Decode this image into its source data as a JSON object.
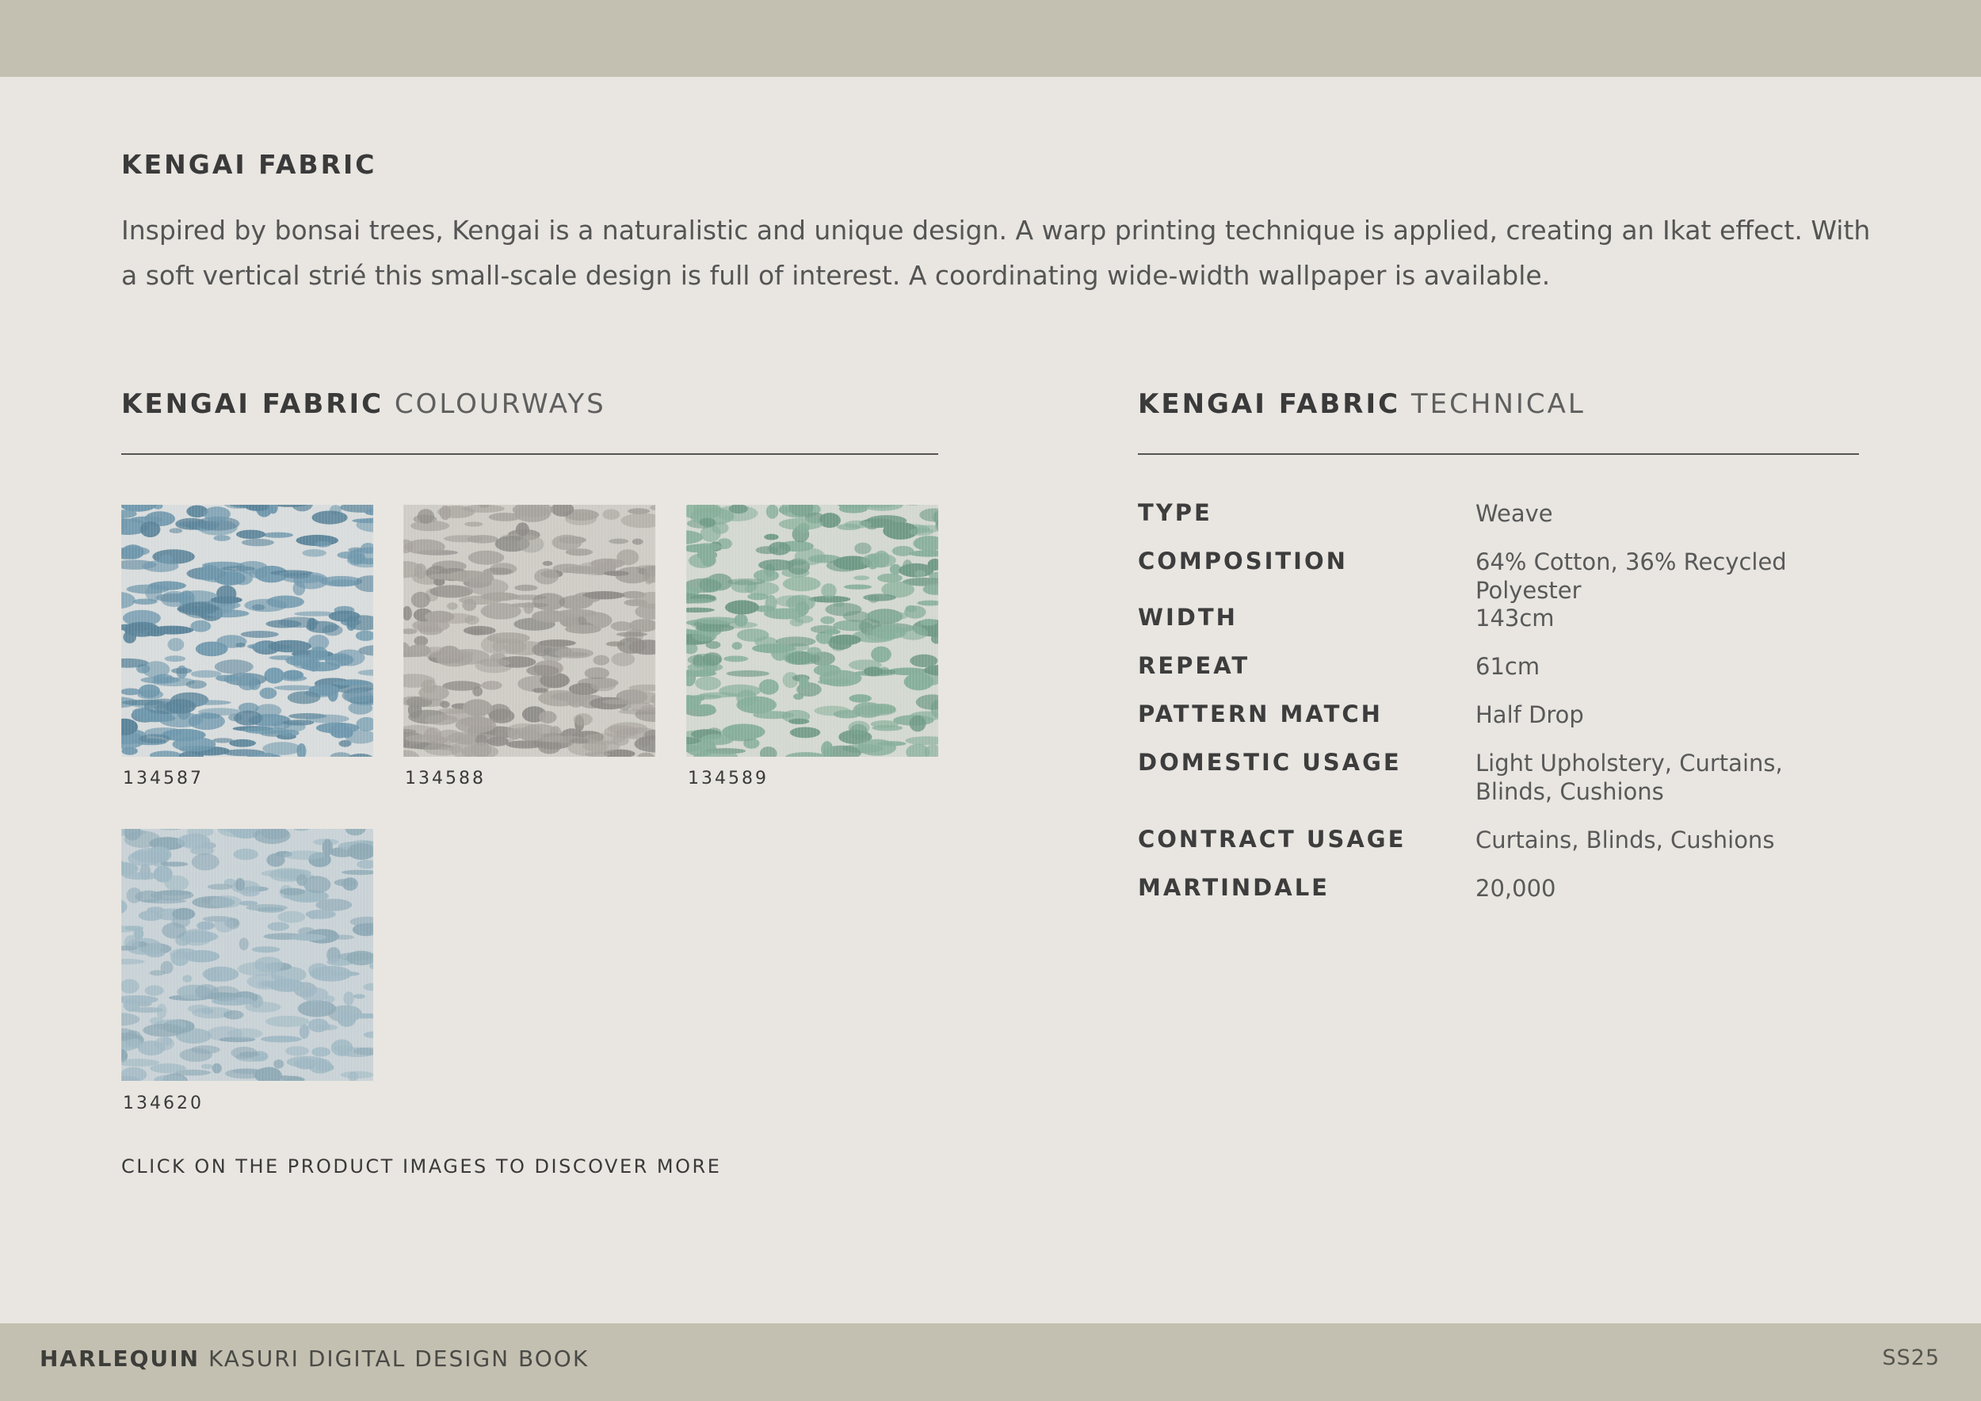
{
  "title": "KENGAI FABRIC",
  "description": "Inspired by bonsai trees, Kengai is a naturalistic and unique design. A warp printing technique is applied, creating an Ikat effect. With a soft vertical strié this small-scale design is full of interest. A coordinating wide-width wallpaper is available.",
  "colourways": {
    "heading_strong": "KENGAI FABRIC",
    "heading_light": "COLOURWAYS",
    "swatches": [
      {
        "code": "134587",
        "colors": {
          "bg": "#d8dcdc",
          "fg": "#6e97ac",
          "dark": "#5a8399"
        }
      },
      {
        "code": "134588",
        "colors": {
          "bg": "#cfccc6",
          "fg": "#a6a29d",
          "dark": "#8f8c88"
        }
      },
      {
        "code": "134589",
        "colors": {
          "bg": "#d3d8d0",
          "fg": "#86ae9a",
          "dark": "#6f9985"
        }
      },
      {
        "code": "134620",
        "colors": {
          "bg": "#c9d2d6",
          "fg": "#9fb8c3",
          "dark": "#8ea9b5"
        }
      }
    ],
    "cta": "CLICK ON THE PRODUCT IMAGES TO DISCOVER MORE"
  },
  "technical": {
    "heading_strong": "KENGAI FABRIC",
    "heading_light": "TECHNICAL",
    "rows": [
      {
        "label": "TYPE",
        "value": "Weave"
      },
      {
        "label": "COMPOSITION",
        "value": "64% Cotton, 36% Recycled Polyester"
      },
      {
        "label": "WIDTH",
        "value": "143cm"
      },
      {
        "label": "REPEAT",
        "value": "61cm"
      },
      {
        "label": "PATTERN MATCH",
        "value": "Half Drop"
      },
      {
        "label": "DOMESTIC USAGE",
        "value": "Light Upholstery, Curtains, Blinds, Cushions"
      },
      {
        "label": "CONTRACT USAGE",
        "value": "Curtains, Blinds, Cushions"
      },
      {
        "label": "MARTINDALE",
        "value": "20,000"
      }
    ]
  },
  "footer": {
    "brand": "HARLEQUIN",
    "book": "KASURI DIGITAL DESIGN BOOK",
    "season": "SS25"
  },
  "colors": {
    "band": "#c3c0b1",
    "page_bg": "#e9e6e1"
  }
}
